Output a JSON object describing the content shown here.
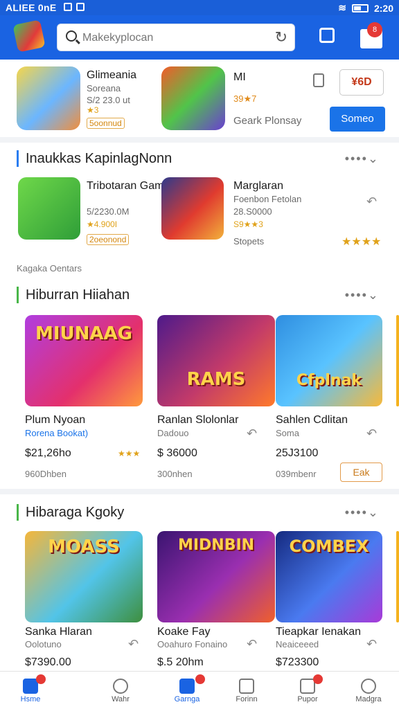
{
  "status": {
    "left": "ALIEE 0nE",
    "time": "2:20"
  },
  "header": {
    "search_placeholder": "Makekyplocan",
    "badge": "8"
  },
  "featured": [
    {
      "name": "Glimeania",
      "sub": "Soreana",
      "meta": "S/2 23.0 ut",
      "stars": "★3",
      "tag": "5oonnud"
    },
    {
      "name": "MI",
      "sub": "39★7",
      "meta": "Geark Plonsay"
    }
  ],
  "featured_buttons": {
    "promo": "¥6D",
    "action": "Someo"
  },
  "section1": {
    "title": "Inaukkas KapinlagNonn",
    "items": [
      {
        "name": "Tribotaran Game",
        "meta": "5/2230.0M",
        "stars": "★4.900I",
        "tag": "2oeonond"
      },
      {
        "name": "Marglaran",
        "meta": "Foenbon Fetolan",
        "sub": "28.S0000",
        "stars": "S9★★3",
        "extra": "Stopets",
        "stars2": "★★★★"
      }
    ]
  },
  "label_small": "Kagaka Oentars",
  "section2": {
    "title": "Hiburran Hiiahan",
    "cards": [
      {
        "art": "MIUNAAG",
        "name": "Plum Nyoan",
        "sub": "Rorena Bookat)",
        "price": "$21,26ho",
        "stars": "★★★",
        "size": "960Dhben"
      },
      {
        "art": "RAMS",
        "name": "Ranlan Slolonlar",
        "sub": "Dadouo",
        "price": "$ 36000",
        "size": "300nhen"
      },
      {
        "art": "Cfplnak",
        "name": "Sahlen Cdlitan",
        "sub": "Soma",
        "price": "25J3100",
        "size": "039mbenr",
        "button": "Eak"
      }
    ]
  },
  "section3": {
    "title": "Hibaraga Kgoky",
    "cards": [
      {
        "art": "MOASS",
        "name": "Sanka Hlaran",
        "sub": "Oolotuno",
        "price": "$7390.00"
      },
      {
        "art": "MIDNBIN",
        "name": "Koake Fay",
        "sub": "Ooahuro Fonaino",
        "price": "$.5 20hm"
      },
      {
        "art": "COMBEX",
        "name": "Tieapkar Ienakan",
        "sub": "Neaiceeed",
        "price": "$723300"
      }
    ]
  },
  "nav": [
    {
      "label": "Hsme"
    },
    {
      "label": "Wahr"
    },
    {
      "label": "Garnga"
    },
    {
      "label": "Forinn"
    },
    {
      "label": "Pupor"
    },
    {
      "label": "Madgra"
    }
  ]
}
